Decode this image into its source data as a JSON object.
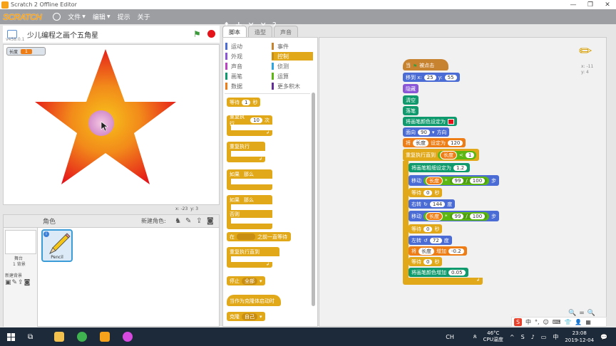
{
  "window": {
    "title": "Scratch 2 Offline Editor",
    "minimize": "—",
    "restore": "❐",
    "close": "✕"
  },
  "menubar": {
    "logo": "SCRATCH",
    "items": [
      {
        "label": "文件",
        "caret": "▼"
      },
      {
        "label": "编辑",
        "caret": "▼"
      },
      {
        "label": "提示"
      },
      {
        "label": "关于"
      }
    ],
    "tools": [
      "⬆",
      "✛",
      "✕",
      "✕",
      "?"
    ]
  },
  "stage": {
    "title": "少儿编程之画个五角星",
    "version": "v458.0.1",
    "monitor": {
      "name": "长度",
      "value": "1"
    },
    "coords": {
      "x_label": "x:",
      "x": "-23",
      "y_label": "y:",
      "y": "3"
    }
  },
  "sprites": {
    "header": "角色",
    "new_sprite_label": "新建角色:",
    "stage_label": "舞台",
    "stage_bg_count": "1 背景",
    "new_backdrop_label": "新建背景",
    "items": [
      {
        "name": "Pencil"
      }
    ]
  },
  "tabs": [
    {
      "label": "脚本",
      "active": true
    },
    {
      "label": "造型"
    },
    {
      "label": "声音"
    }
  ],
  "categories": [
    {
      "label": "运动",
      "color": "#4a6cd4"
    },
    {
      "label": "事件",
      "color": "#c88330"
    },
    {
      "label": "外观",
      "color": "#8a55d7"
    },
    {
      "label": "控制",
      "color": "#e1a91a",
      "selected": true
    },
    {
      "label": "声音",
      "color": "#bb42c3"
    },
    {
      "label": "侦测",
      "color": "#2ca5e2"
    },
    {
      "label": "画笔",
      "color": "#0e9a6c"
    },
    {
      "label": "运算",
      "color": "#5cb712"
    },
    {
      "label": "数据",
      "color": "#ee7d16"
    },
    {
      "label": "更多积木",
      "color": "#632d99"
    }
  ],
  "palette": {
    "wait": {
      "label": "等待",
      "value": "1",
      "unit": "秒"
    },
    "repeat": {
      "label": "重复执行",
      "value": "10",
      "unit": "次"
    },
    "forever": {
      "label": "重复执行"
    },
    "if_then": {
      "label": "如果",
      "then": "那么"
    },
    "if_else": {
      "label": "如果",
      "then": "那么",
      "else": "否则"
    },
    "wait_until": {
      "label": "在",
      "suffix": "之前一直等待"
    },
    "repeat_until": {
      "label": "重复执行直到"
    },
    "stop": {
      "label": "停止",
      "option": "全部"
    },
    "clone_start": {
      "label": "当作为克隆体启动时"
    },
    "clone": {
      "label": "克隆",
      "option": "自己"
    }
  },
  "script": {
    "hat": {
      "label": "当",
      "suffix": "被点击"
    },
    "goto": {
      "label": "移到 x:",
      "x": "25",
      "y_label": "y:",
      "y": "55"
    },
    "hide": "隐藏",
    "clear": "清空",
    "pen_down": "落笔",
    "set_color": "将画笔颜色设定为",
    "point": {
      "label": "面向",
      "value": "90",
      "suffix": "方向"
    },
    "set_var": {
      "label": "将",
      "var": "长度",
      "mid": "设定为",
      "value": "120"
    },
    "repeat_until": {
      "label": "重复执行直到",
      "var": "长度",
      "op": "<",
      "value": "1"
    },
    "pen_size": {
      "label": "将画笔粗细设定为",
      "value": "1.2"
    },
    "move1": {
      "label": "移动",
      "var": "长度",
      "op": "*",
      "a": "99",
      "div": "/",
      "b": "100",
      "suffix": "步"
    },
    "wait1": {
      "label": "等待",
      "value": "0",
      "unit": "秒"
    },
    "turn_right": {
      "label": "右转",
      "value": "144",
      "unit": "度"
    },
    "move2": {
      "label": "移动",
      "var": "长度",
      "op": "*",
      "a": "99",
      "div": "/",
      "b": "100",
      "suffix": "步"
    },
    "wait2": {
      "label": "等待",
      "value": "0",
      "unit": "秒"
    },
    "turn_left": {
      "label": "左转",
      "value": "72",
      "unit": "度"
    },
    "change_var": {
      "label": "将",
      "var": "长度",
      "mid": "增加",
      "value": "-0.2"
    },
    "wait3": {
      "label": "等待",
      "value": "0",
      "unit": "秒"
    },
    "change_color": {
      "label": "将画笔颜色增加",
      "value": "0.05"
    },
    "sprite_info": {
      "x": "x: -11",
      "y": "y: 4"
    }
  },
  "zoom": {
    "out": "🔍",
    "reset": "=",
    "in": "🔍"
  },
  "ime": {
    "logo": "S",
    "lang": "中",
    "items": [
      "°,",
      "☺",
      "⌨",
      "👕",
      "👤",
      "▦"
    ]
  },
  "taskbar": {
    "ime_label": "CH",
    "weather": {
      "temp": "46°C",
      "label": "CPU温度"
    },
    "clock": {
      "time": "23:08",
      "date": "2019-12-04"
    },
    "notify": "💬"
  },
  "colors": {
    "star_outer": "#e4141a",
    "star_inner": "#f7a21b",
    "cursor_glow": "#d99cf0"
  }
}
